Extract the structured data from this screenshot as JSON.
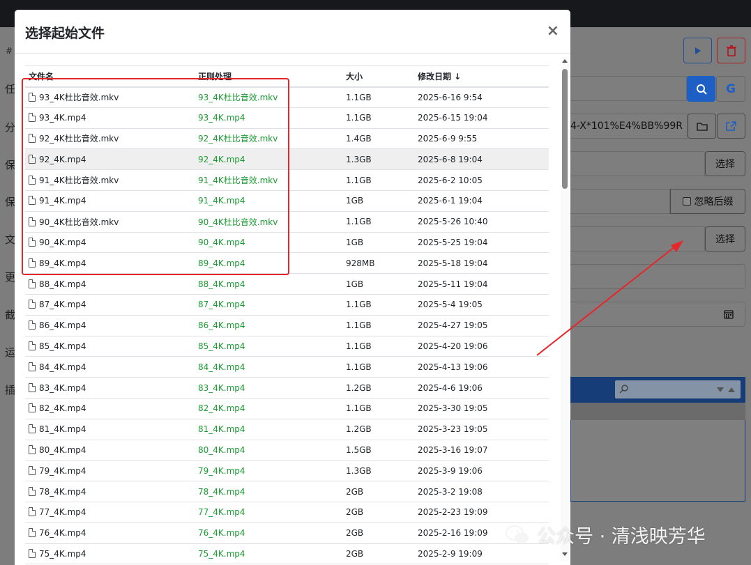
{
  "modal": {
    "title": "选择起始文件",
    "close": "×",
    "columns": {
      "name": "文件名",
      "regex": "正则处理",
      "size": "大小",
      "date": "修改日期 ↓"
    },
    "rows": [
      {
        "name": "93_4K杜比音效.mkv",
        "regex": "93_4K杜比音效.mkv",
        "size": "1.1GB",
        "date": "2025-6-16 9:54"
      },
      {
        "name": "93_4K.mp4",
        "regex": "93_4K.mp4",
        "size": "1.1GB",
        "date": "2025-6-15 19:04"
      },
      {
        "name": "92_4K杜比音效.mkv",
        "regex": "92_4K杜比音效.mkv",
        "size": "1.4GB",
        "date": "2025-6-9 9:55"
      },
      {
        "name": "92_4K.mp4",
        "regex": "92_4K.mp4",
        "size": "1.3GB",
        "date": "2025-6-8 19:04"
      },
      {
        "name": "91_4K杜比音效.mkv",
        "regex": "91_4K杜比音效.mkv",
        "size": "1.1GB",
        "date": "2025-6-2 10:05"
      },
      {
        "name": "91_4K.mp4",
        "regex": "91_4K.mp4",
        "size": "1GB",
        "date": "2025-6-1 19:04"
      },
      {
        "name": "90_4K杜比音效.mkv",
        "regex": "90_4K杜比音效.mkv",
        "size": "1.1GB",
        "date": "2025-5-26 10:40"
      },
      {
        "name": "90_4K.mp4",
        "regex": "90_4K.mp4",
        "size": "1GB",
        "date": "2025-5-25 19:04"
      },
      {
        "name": "89_4K.mp4",
        "regex": "89_4K.mp4",
        "size": "928MB",
        "date": "2025-5-18 19:04"
      },
      {
        "name": "88_4K.mp4",
        "regex": "88_4K.mp4",
        "size": "1GB",
        "date": "2025-5-11 19:04"
      },
      {
        "name": "87_4K.mp4",
        "regex": "87_4K.mp4",
        "size": "1.1GB",
        "date": "2025-5-4 19:05"
      },
      {
        "name": "86_4K.mp4",
        "regex": "86_4K.mp4",
        "size": "1.1GB",
        "date": "2025-4-27 19:05"
      },
      {
        "name": "85_4K.mp4",
        "regex": "85_4K.mp4",
        "size": "1.1GB",
        "date": "2025-4-20 19:06"
      },
      {
        "name": "84_4K.mp4",
        "regex": "84_4K.mp4",
        "size": "1.1GB",
        "date": "2025-4-13 19:06"
      },
      {
        "name": "83_4K.mp4",
        "regex": "83_4K.mp4",
        "size": "1.2GB",
        "date": "2025-4-6 19:06"
      },
      {
        "name": "82_4K.mp4",
        "regex": "82_4K.mp4",
        "size": "1.1GB",
        "date": "2025-3-30 19:05"
      },
      {
        "name": "81_4K.mp4",
        "regex": "81_4K.mp4",
        "size": "1.2GB",
        "date": "2025-3-23 19:05"
      },
      {
        "name": "80_4K.mp4",
        "regex": "80_4K.mp4",
        "size": "1.5GB",
        "date": "2025-3-16 19:07"
      },
      {
        "name": "79_4K.mp4",
        "regex": "79_4K.mp4",
        "size": "1.3GB",
        "date": "2025-3-9 19:06"
      },
      {
        "name": "78_4K.mp4",
        "regex": "78_4K.mp4",
        "size": "2GB",
        "date": "2025-3-2 19:08"
      },
      {
        "name": "77_4K.mp4",
        "regex": "77_4K.mp4",
        "size": "2GB",
        "date": "2025-2-23 19:09"
      },
      {
        "name": "76_4K.mp4",
        "regex": "76_4K.mp4",
        "size": "2GB",
        "date": "2025-2-16 19:09"
      },
      {
        "name": "75_4K.mp4",
        "regex": "75_4K.mp4",
        "size": "2GB",
        "date": "2025-2-9 19:09"
      }
    ]
  },
  "background": {
    "hash": "#",
    "labels": [
      "任",
      "分",
      "保",
      "保",
      "文",
      "更",
      "截",
      "运",
      "插"
    ],
    "path_text": "4-X*101%E4%BB%99R",
    "select_label": "选择",
    "ignore_suffix_label": "忽略后缀",
    "colors": {
      "run_blue": "#1d4f9a",
      "delete_red": "#b01e23",
      "search_blue": "#1d5fc4"
    }
  },
  "watermark": {
    "text": "公众号 · 清浅映芳华"
  }
}
